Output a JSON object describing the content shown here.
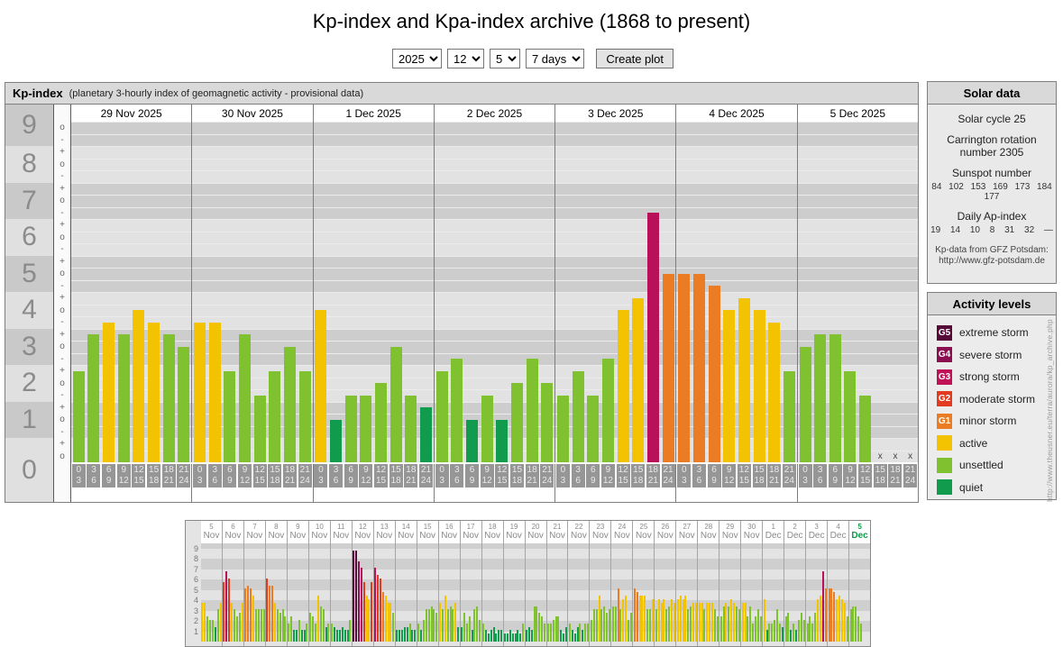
{
  "page": {
    "title": "Kp-index and Kpa-index archive (1868 to present)"
  },
  "controls": {
    "selects": [
      {
        "name": "year-select",
        "value": "2025"
      },
      {
        "name": "month-select",
        "value": "12"
      },
      {
        "name": "day-select",
        "value": "5"
      },
      {
        "name": "range-select",
        "value": "7 days"
      }
    ],
    "create_button": "Create plot"
  },
  "kp_panel": {
    "title": "Kp-index",
    "subtitle": "(planetary 3-hourly index of geomagnetic activity - provisional data)"
  },
  "solar_panel": {
    "title": "Solar data",
    "cycle": "Solar cycle 25",
    "carrington": "Carrington rotation number 2305",
    "sunspot_label": "Sunspot number",
    "sunspot_values": "84 102 153 169 173 184 177",
    "ap_label": "Daily Ap-index",
    "ap_values": "19 14 10 8 31 32 —",
    "credit_line1": "Kp-data from GFZ Potsdam:",
    "credit_line2": "http://www.gfz-potsdam.de"
  },
  "activity_panel": {
    "title": "Activity levels",
    "levels": [
      {
        "badge": "G5",
        "label": "extreme storm",
        "color": "#550a38"
      },
      {
        "badge": "G4",
        "label": "severe storm",
        "color": "#8a0e50"
      },
      {
        "badge": "G3",
        "label": "strong storm",
        "color": "#c01357"
      },
      {
        "badge": "G2",
        "label": "moderate storm",
        "color": "#e23b20"
      },
      {
        "badge": "G1",
        "label": "minor storm",
        "color": "#eb7c23"
      },
      {
        "badge": "",
        "label": "active",
        "color": "#f3c301"
      },
      {
        "badge": "",
        "label": "unsettled",
        "color": "#7fc12e"
      },
      {
        "badge": "",
        "label": "quiet",
        "color": "#119b4d"
      }
    ]
  },
  "watermark": "http://www.theusner.eu/terra/aurora/kp_archive.php",
  "bar_colors": {
    "quiet": "#119b4d",
    "unsettled": "#7fc12e",
    "active": "#f3c301",
    "g1": "#eb7c23",
    "g2": "#e23b20",
    "g3": "#b8115a",
    "g4": "#8a0e50",
    "g5": "#550a38"
  },
  "chart_data": [
    {
      "type": "bar",
      "name": "kp-main-7day",
      "title": "Kp-index",
      "ylim": [
        0,
        9.33
      ],
      "grid": "banded",
      "missing_marker": "x",
      "y_labels": [
        "9",
        "8",
        "7",
        "6",
        "5",
        "4",
        "3",
        "2",
        "1",
        "0"
      ],
      "sub_levels": [
        "-",
        "o",
        "+"
      ],
      "hours": [
        [
          "0",
          "3"
        ],
        [
          "3",
          "6"
        ],
        [
          "6",
          "9"
        ],
        [
          "9",
          "12"
        ],
        [
          "12",
          "15"
        ],
        [
          "15",
          "18"
        ],
        [
          "18",
          "21"
        ],
        [
          "21",
          "24"
        ]
      ],
      "days": [
        {
          "date": "29 Nov 2025",
          "values": [
            "2+",
            "3+",
            "4-",
            "3+",
            "4o",
            "4-",
            "3+",
            "3o"
          ]
        },
        {
          "date": "30 Nov 2025",
          "values": [
            "4-",
            "4-",
            "2+",
            "3+",
            "2-",
            "2+",
            "3o",
            "2+"
          ]
        },
        {
          "date": "1 Dec 2025",
          "values": [
            "4o",
            "1o",
            "2-",
            "2-",
            "2o",
            "3o",
            "2-",
            "1+"
          ]
        },
        {
          "date": "2 Dec 2025",
          "values": [
            "2+",
            "3-",
            "1o",
            "2-",
            "1o",
            "2o",
            "3-",
            "2o"
          ]
        },
        {
          "date": "3 Dec 2025",
          "values": [
            "2-",
            "2+",
            "2-",
            "3-",
            "4o",
            "4+",
            "7-",
            "5o"
          ]
        },
        {
          "date": "4 Dec 2025",
          "values": [
            "5o",
            "5o",
            "5-",
            "4o",
            "4+",
            "4o",
            "4-",
            "2+"
          ]
        },
        {
          "date": "5 Dec 2025",
          "values": [
            "3o",
            "3+",
            "3+",
            "2+",
            "2-",
            "x",
            "x",
            "x"
          ]
        }
      ]
    },
    {
      "type": "bar",
      "name": "kp-overview-31day",
      "title": "Kp-index last 31 days overview",
      "ylim": [
        0,
        9.5
      ],
      "grid": "banded",
      "y_labels": [
        "9",
        "8",
        "7",
        "6",
        "5",
        "4",
        "3",
        "2",
        "1"
      ],
      "current_day_color": "#0d9b48",
      "days": [
        {
          "d": "5",
          "m": "Nov",
          "values": [
            "4-",
            "4-",
            "2+",
            "2o",
            "2o",
            "1+",
            "3o",
            "4-"
          ]
        },
        {
          "d": "6",
          "m": "Nov",
          "values": [
            "6-",
            "7-",
            "6o",
            "4-",
            "3o",
            "2+",
            "3-",
            "4-"
          ]
        },
        {
          "d": "7",
          "m": "Nov",
          "values": [
            "5o",
            "5+",
            "5o",
            "4+",
            "3o",
            "3o",
            "3o",
            "3o"
          ]
        },
        {
          "d": "8",
          "m": "Nov",
          "values": [
            "6o",
            "5+",
            "5+",
            "4-",
            "3o",
            "3-",
            "3o",
            "2+"
          ]
        },
        {
          "d": "9",
          "m": "Nov",
          "values": [
            "2-",
            "2+",
            "1o",
            "1o",
            "2o",
            "1o",
            "1o",
            "2-"
          ]
        },
        {
          "d": "10",
          "m": "Nov",
          "values": [
            "3-",
            "2+",
            "2-",
            "4+",
            "3+",
            "3o",
            "1+",
            "2-"
          ]
        },
        {
          "d": "11",
          "m": "Nov",
          "values": [
            "2-",
            "1+",
            "1o",
            "1o",
            "1+",
            "1o",
            "1o",
            "2o"
          ]
        },
        {
          "d": "12",
          "m": "Nov",
          "values": [
            "9-",
            "9-",
            "8-",
            "7o",
            "6-",
            "4+",
            "4o",
            "6-"
          ]
        },
        {
          "d": "13",
          "m": "Nov",
          "values": [
            "7o",
            "6+",
            "6o",
            "5-",
            "4+",
            "4-",
            "4-",
            "3-"
          ]
        },
        {
          "d": "14",
          "m": "Nov",
          "values": [
            "1o",
            "1o",
            "1o",
            "1+",
            "1+",
            "2-",
            "1o",
            "1o"
          ]
        },
        {
          "d": "15",
          "m": "Nov",
          "values": [
            "2-",
            "1o",
            "2o",
            "3o",
            "3o",
            "3+",
            "3o",
            "3-"
          ]
        },
        {
          "d": "16",
          "m": "Nov",
          "values": [
            "4-",
            "3o",
            "4+",
            "3o",
            "3+",
            "3o",
            "4-",
            "1+"
          ]
        },
        {
          "d": "17",
          "m": "Nov",
          "values": [
            "1+",
            "3-",
            "2-",
            "2+",
            "1o",
            "3o",
            "3+",
            "2o"
          ]
        },
        {
          "d": "18",
          "m": "Nov",
          "values": [
            "2-",
            "1o",
            "1-",
            "1o",
            "1+",
            "1-",
            "1o",
            "1o"
          ]
        },
        {
          "d": "19",
          "m": "Nov",
          "values": [
            "1-",
            "1-",
            "1o",
            "1-",
            "1-",
            "1o",
            "1-",
            "2-"
          ]
        },
        {
          "d": "20",
          "m": "Nov",
          "values": [
            "1o",
            "1+",
            "1o",
            "3+",
            "3+",
            "3-",
            "2+",
            "2-"
          ]
        },
        {
          "d": "21",
          "m": "Nov",
          "values": [
            "2-",
            "2-",
            "2o",
            "2+",
            "2+",
            "1o",
            "1-",
            "1+"
          ]
        },
        {
          "d": "22",
          "m": "Nov",
          "values": [
            "2-",
            "1o",
            "1-",
            "1+",
            "2-",
            "1o",
            "2-",
            "2-"
          ]
        },
        {
          "d": "23",
          "m": "Nov",
          "values": [
            "2o",
            "3o",
            "3o",
            "4+",
            "3o",
            "3+",
            "3-",
            "3o"
          ]
        },
        {
          "d": "24",
          "m": "Nov",
          "values": [
            "3+",
            "3+",
            "5o",
            "3o",
            "4o",
            "4+",
            "2o",
            "3-"
          ]
        },
        {
          "d": "25",
          "m": "Nov",
          "values": [
            "5o",
            "5-",
            "4+",
            "4+",
            "4+",
            "3o",
            "3o",
            "4o"
          ]
        },
        {
          "d": "26",
          "m": "Nov",
          "values": [
            "3o",
            "4o",
            "4-",
            "4o",
            "3o",
            "3+",
            "4o",
            "4-"
          ]
        },
        {
          "d": "27",
          "m": "Nov",
          "values": [
            "4o",
            "4+",
            "4o",
            "4+",
            "3o",
            "3+",
            "4-",
            "4-"
          ]
        },
        {
          "d": "28",
          "m": "Nov",
          "values": [
            "4-",
            "4-",
            "3o",
            "4-",
            "4-",
            "4-",
            "3o",
            "2+"
          ]
        },
        {
          "d": "29",
          "m": "Nov",
          "values": [
            "2+",
            "3+",
            "4-",
            "3+",
            "4o",
            "4-",
            "3+",
            "3o"
          ]
        },
        {
          "d": "30",
          "m": "Nov",
          "values": [
            "4-",
            "4-",
            "2+",
            "3+",
            "2-",
            "2+",
            "3o",
            "2+"
          ]
        },
        {
          "d": "1",
          "m": "Dec",
          "values": [
            "4o",
            "1o",
            "2-",
            "2-",
            "2o",
            "3o",
            "2-",
            "1+"
          ]
        },
        {
          "d": "2",
          "m": "Dec",
          "values": [
            "2+",
            "3-",
            "1o",
            "2-",
            "1o",
            "2o",
            "3-",
            "2o"
          ]
        },
        {
          "d": "3",
          "m": "Dec",
          "values": [
            "2-",
            "2+",
            "2-",
            "3-",
            "4o",
            "4+",
            "7-",
            "5o"
          ]
        },
        {
          "d": "4",
          "m": "Dec",
          "values": [
            "5o",
            "5o",
            "5-",
            "4o",
            "4+",
            "4o",
            "4-",
            "2+"
          ]
        },
        {
          "d": "5",
          "m": "Dec",
          "current": true,
          "values": [
            "3o",
            "3+",
            "3+",
            "2+",
            "2-",
            "x",
            "x",
            "x"
          ]
        }
      ]
    }
  ]
}
